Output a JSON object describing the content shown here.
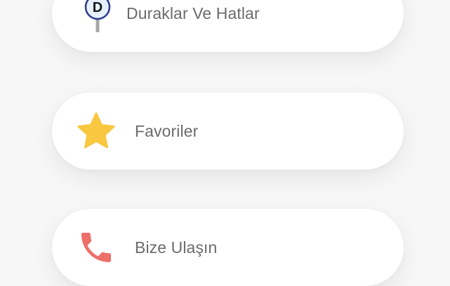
{
  "menu": {
    "items": [
      {
        "label": "Duraklar Ve Hatlar",
        "icon": "bus-stop-icon",
        "icon_letter": "D"
      },
      {
        "label": "Favoriler",
        "icon": "star-icon"
      },
      {
        "label": "Bize Ulaşın",
        "icon": "phone-icon"
      }
    ]
  },
  "colors": {
    "background": "#f7f7f7",
    "card": "#ffffff",
    "label_text": "#6b6b6b",
    "star": "#f9c740",
    "phone": "#ed6f6a",
    "stop_ring": "#2d3a8c",
    "stop_pole": "#a8a8a8"
  }
}
